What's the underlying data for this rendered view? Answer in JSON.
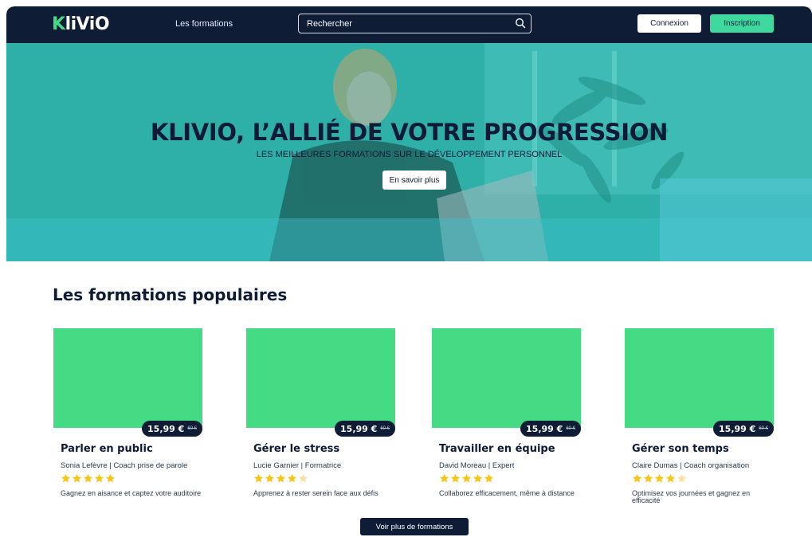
{
  "colors": {
    "navy": "#0e1c36",
    "green": "#45db85",
    "accent": "#3fd9a0",
    "star": "#f5c518"
  },
  "header": {
    "logo_prefix": "K",
    "logo_rest": "liViO",
    "nav_link": "Les formations",
    "search_placeholder": "Rechercher",
    "login_label": "Connexion",
    "signup_label": "Inscription"
  },
  "hero": {
    "title": "KLIVIO, L’ALLIÉ DE VOTRE PROGRESSION",
    "subtitle": "LES MEILLEURES FORMATIONS SUR LE DÉVELOPPEMENT PERSONNEL",
    "cta_label": "En savoir plus"
  },
  "popular": {
    "title": "Les formations populaires",
    "cards": [
      {
        "title": "Parler en public",
        "author": "Sonia Lefèvre | Coach prise de parole",
        "price": "15,99 €",
        "old_price": "60 €",
        "rating": 5,
        "description": "Gagnez en aisance et captez votre auditoire"
      },
      {
        "title": "Gérer le stress",
        "author": "Lucie Garnier | Formatrice",
        "price": "15,99 €",
        "old_price": "60 €",
        "rating": 4,
        "description": "Apprenez à rester serein face aux défis"
      },
      {
        "title": "Travailler en équipe",
        "author": "David Moreau | Expert",
        "price": "15,99 €",
        "old_price": "60 €",
        "rating": 5,
        "description": "Collaborez efficacement, même à distance"
      },
      {
        "title": "Gérer son temps",
        "author": "Claire Dumas | Coach organisation",
        "price": "15,99 €",
        "old_price": "60 €",
        "rating": 4,
        "description": "Optimisez vos journées et gagnez en efficacité"
      }
    ],
    "more_label": "Voir plus de formations"
  }
}
